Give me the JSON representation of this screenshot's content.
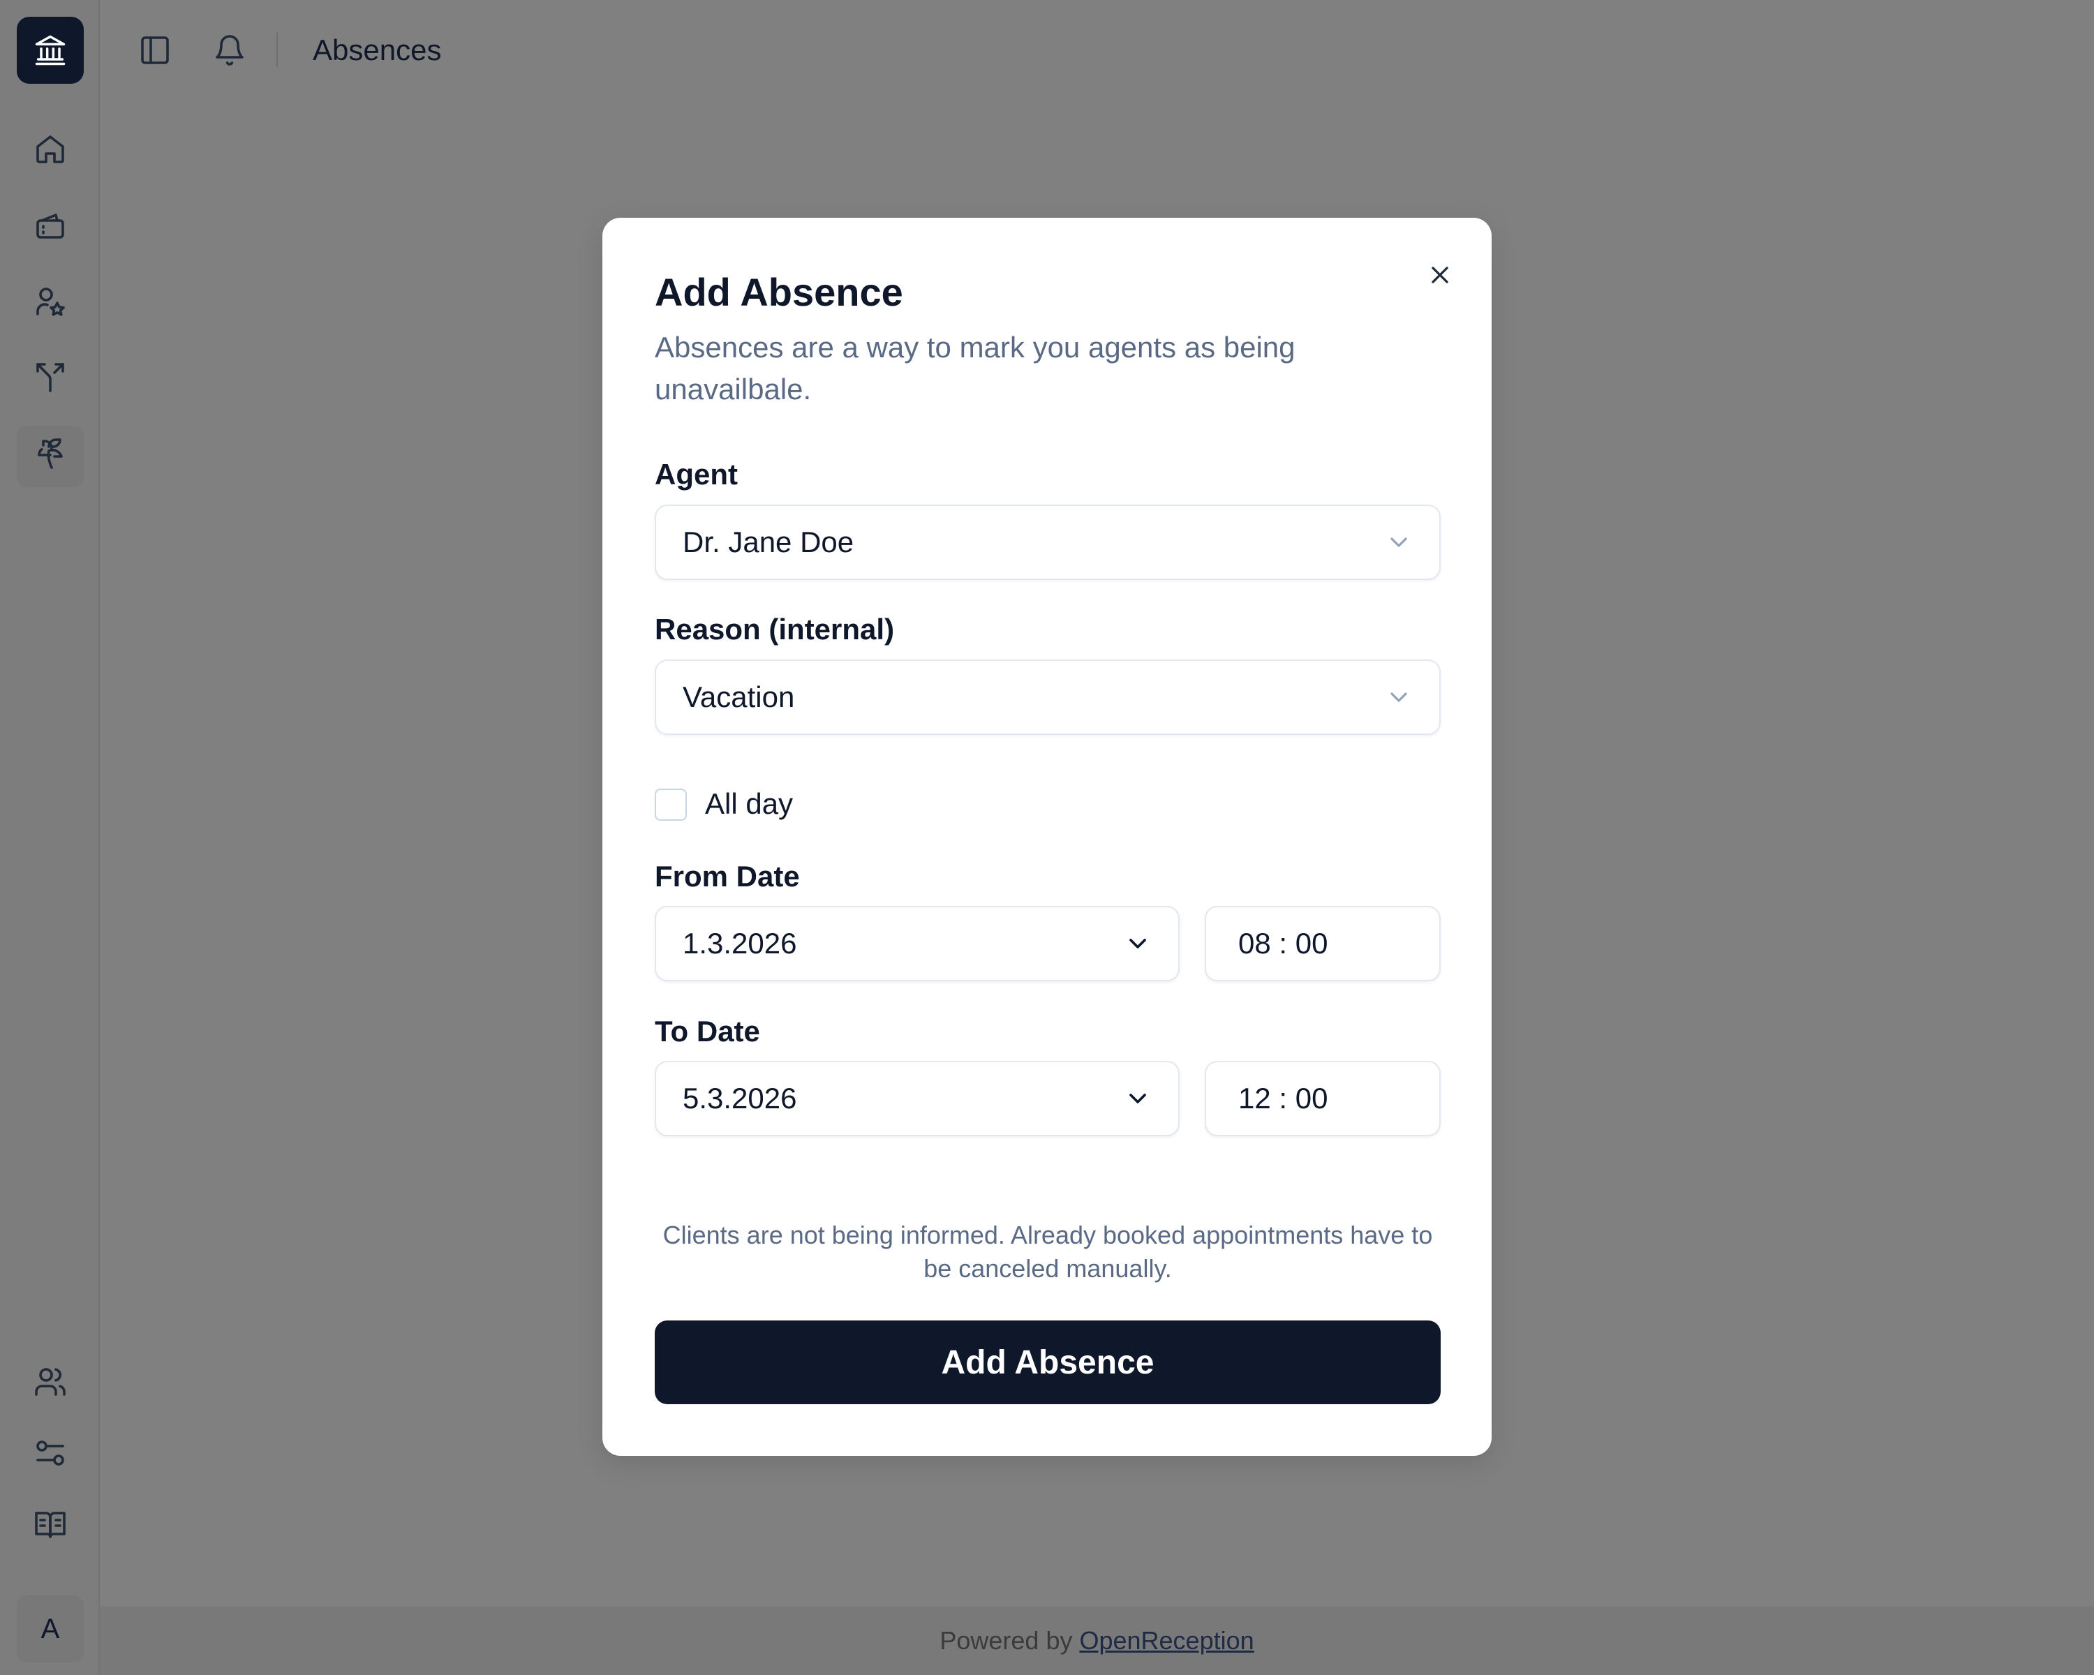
{
  "header": {
    "title": "Absences"
  },
  "sidebar": {
    "logo_icon": "bank-icon",
    "items": [
      {
        "icon": "home-icon"
      },
      {
        "icon": "ticket-icon"
      },
      {
        "icon": "user-star-icon"
      },
      {
        "icon": "split-icon"
      },
      {
        "icon": "palm-tree-icon",
        "active": true
      },
      {
        "icon": "users-icon"
      },
      {
        "icon": "sliders-icon"
      },
      {
        "icon": "book-open-icon"
      }
    ],
    "avatar_initial": "A"
  },
  "modal": {
    "title": "Add Absence",
    "description": "Absences are a way to mark you agents as being unavailbale.",
    "agent": {
      "label": "Agent",
      "value": "Dr. Jane Doe"
    },
    "reason": {
      "label": "Reason (internal)",
      "value": "Vacation"
    },
    "all_day": {
      "label": "All day",
      "checked": false
    },
    "from": {
      "label": "From Date",
      "date": "1.3.2026",
      "time": "08 : 00"
    },
    "to": {
      "label": "To Date",
      "date": "5.3.2026",
      "time": "12 : 00"
    },
    "notice": "Clients are not being informed. Already booked appointments have to be canceled manually.",
    "submit_label": "Add Absence"
  },
  "footer": {
    "prefix": "Powered by ",
    "link": "OpenReception"
  },
  "colors": {
    "primary": "#0f172a",
    "muted": "#5a6a85",
    "overlay": "#808080"
  }
}
